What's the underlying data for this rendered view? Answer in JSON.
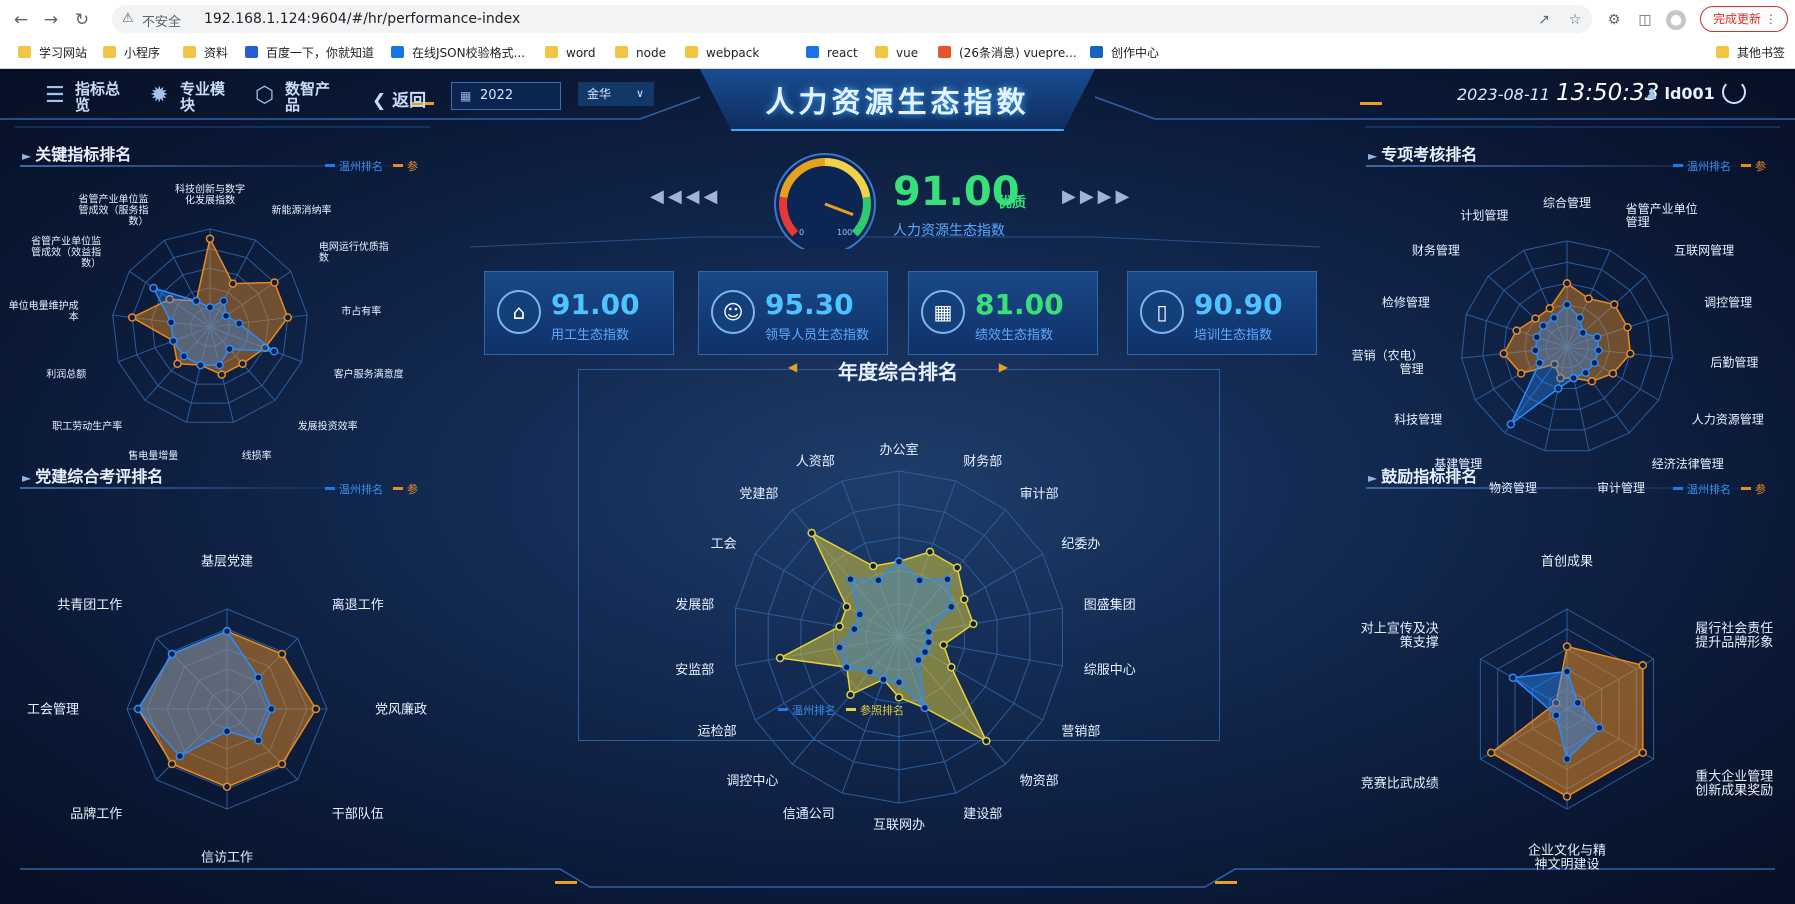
{
  "browser": {
    "security": "不安全",
    "url": "192.168.1.124:9604/#/hr/performance-index",
    "update_button": "完成更新",
    "bookmarks": [
      "学习网站",
      "小程序",
      "资料",
      "百度一下，你就知道",
      "在线JSON校验格式...",
      "word",
      "node",
      "webpack",
      "react",
      "vue",
      "(26条消息) vuepre...",
      "创作中心"
    ],
    "other_bookmarks": "其他书签"
  },
  "header": {
    "title": "人力资源生态指数",
    "nav": [
      {
        "label": "指标总览",
        "icon": "layers-icon"
      },
      {
        "label": "专业模块",
        "icon": "nodes-icon"
      },
      {
        "label": "数智产品",
        "icon": "cube-icon"
      }
    ],
    "back_label": "返回",
    "year": "2022",
    "city": "金华",
    "date": "2023-08-11",
    "time": "13:50:33",
    "user": "ld001"
  },
  "legend": {
    "a": "温州排名",
    "b": "参"
  },
  "gauge": {
    "score": "91.00",
    "grade": "优质",
    "label": "人力资源生态指数",
    "min_label": "0",
    "max_label": "100",
    "value": 91
  },
  "cards": [
    {
      "value": "91.00",
      "label": "用工生态指数",
      "color": "#4fc3ff",
      "icon": "home-icon"
    },
    {
      "value": "95.30",
      "label": "领导人员生态指数",
      "color": "#4fc3ff",
      "icon": "person-icon"
    },
    {
      "value": "81.00",
      "label": "绩效生态指数",
      "color": "#38e07a",
      "icon": "table-icon"
    },
    {
      "value": "90.90",
      "label": "培训生态指数",
      "color": "#4fc3ff",
      "icon": "book-icon"
    }
  ],
  "panels": {
    "key_indicators": "关键指标排名",
    "party": "党建综合考评排名",
    "special": "专项考核排名",
    "incentive": "鼓励指标排名",
    "annual": "年度综合排名"
  },
  "annual_legend": {
    "a": "温州排名",
    "b": "参照排名"
  },
  "chart_data": [
    {
      "type": "radar",
      "title": "关键指标排名",
      "categories": [
        "科技创新与数字化发展指数",
        "新能源消纳率",
        "电网运行优质指数",
        "市占有率",
        "客户服务满意度",
        "发展投资效率",
        "线损率",
        "售电量增量",
        "职工劳动生产率",
        "利润总额",
        "单位电量维护成本",
        "省管产业单位监管成效（效益指数）",
        "省管产业单位监管成效（服务指数）"
      ],
      "series": [
        {
          "name": "温州排名",
          "values": [
            2,
            3,
            2,
            3,
            7,
            3,
            4,
            4,
            4,
            4,
            4,
            7,
            3
          ]
        },
        {
          "name": "参",
          "values": [
            9,
            5,
            8,
            8,
            6,
            5,
            5,
            4,
            5,
            4,
            8,
            5,
            3
          ]
        }
      ],
      "max": 10
    },
    {
      "type": "radar",
      "title": "党建综合考评排名",
      "categories": [
        "基层党建",
        "离退工作",
        "党风廉政",
        "干部队伍",
        "信访工作",
        "品牌工作",
        "工会管理",
        "共青团工作"
      ],
      "series": [
        {
          "name": "温州排名",
          "values": [
            7,
            4,
            4,
            4,
            2,
            6,
            8,
            7
          ]
        },
        {
          "name": "参",
          "values": [
            7,
            7,
            8,
            7,
            7,
            7,
            8,
            7
          ]
        }
      ],
      "max": 9
    },
    {
      "type": "radar",
      "title": "年度综合排名",
      "categories": [
        "办公室",
        "财务部",
        "审计部",
        "纪委办",
        "图盛集团",
        "综服中心",
        "营销部",
        "物资部",
        "建设部",
        "互联网办",
        "信通公司",
        "调控中心",
        "运检部",
        "安监部",
        "发展部",
        "工会",
        "党建部",
        "人资部"
      ],
      "series": [
        {
          "name": "温州排名",
          "values": [
            5,
            4,
            5,
            4,
            2,
            2,
            2,
            2,
            5,
            3,
            3,
            3,
            4,
            4,
            3,
            3,
            5,
            4
          ]
        },
        {
          "name": "参照排名",
          "values": [
            5,
            6,
            6,
            5,
            5,
            3,
            4,
            9,
            5,
            4,
            3,
            5,
            4,
            8,
            4,
            4,
            9,
            5
          ]
        }
      ],
      "max": 11
    },
    {
      "type": "radar",
      "title": "专项考核排名",
      "categories": [
        "综合管理",
        "省管产业单位管理",
        "互联网管理",
        "调控管理",
        "后勤管理",
        "人力资源管理",
        "经济法律管理",
        "审计管理",
        "物资管理",
        "基建管理",
        "科技管理",
        "营销（农电）管理",
        "检修管理",
        "财务管理",
        "计划管理"
      ],
      "series": [
        {
          "name": "温州排名",
          "values": [
            4,
            3,
            2,
            3,
            3,
            3,
            3,
            3,
            4,
            9,
            3,
            3,
            3,
            3,
            3
          ]
        },
        {
          "name": "参",
          "values": [
            6,
            5,
            6,
            6,
            6,
            5,
            4,
            3,
            3,
            2,
            5,
            6,
            5,
            4,
            4
          ]
        }
      ],
      "max": 10
    },
    {
      "type": "radar",
      "title": "鼓励指标排名",
      "categories": [
        "首创成果",
        "履行社会责任提升品牌形象",
        "重大企业管理创新成果奖励",
        "企业文化与精神文明建设",
        "竞赛比武成绩",
        "对上宣传及决策支撑"
      ],
      "series": [
        {
          "name": "温州排名",
          "values": [
            3,
            1,
            3,
            4,
            1,
            5
          ]
        },
        {
          "name": "参",
          "values": [
            5,
            7,
            7,
            7,
            7,
            1
          ]
        }
      ],
      "max": 8
    }
  ]
}
